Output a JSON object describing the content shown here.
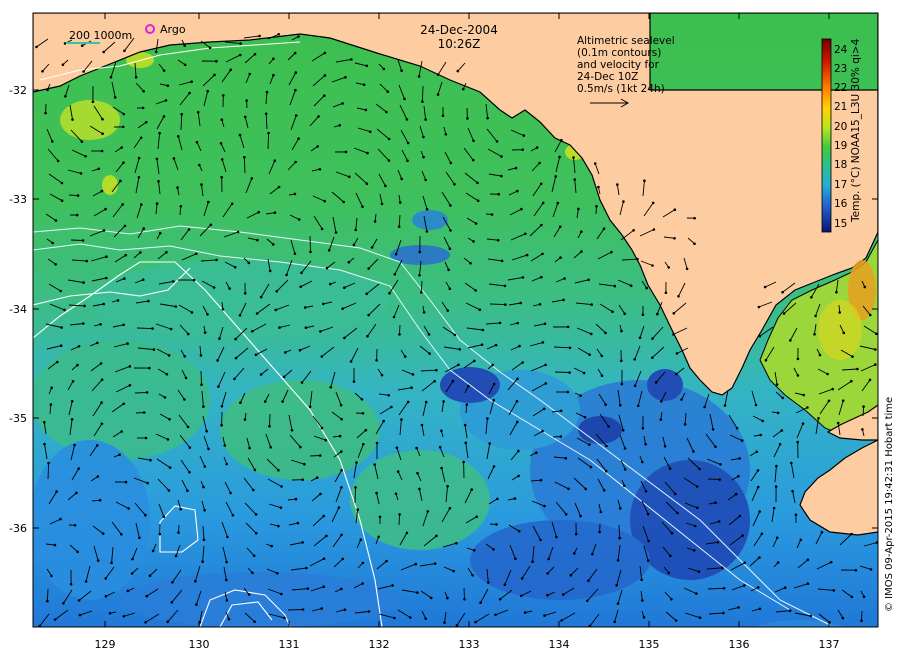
{
  "title": {
    "date": "24-Dec-2004",
    "time": "10:26Z"
  },
  "scale_bar": {
    "label": "200  1000m"
  },
  "argo_legend": {
    "label": "Argo"
  },
  "velocity_note": {
    "lines": [
      "Altimetric sealevel",
      "(0.1m contours)",
      "and velocity for",
      "24-Dec 10Z",
      "0.5m/s (1kt 24h)"
    ]
  },
  "colorbar": {
    "ticks": [
      "24",
      "23",
      "22",
      "21",
      "20",
      "19",
      "18",
      "17",
      "16",
      "15"
    ],
    "label": "Temp. (°C) NOAA15_L3U 30% qi>4",
    "colors": [
      "#7a0000",
      "#b40000",
      "#e63000",
      "#ff7a00",
      "#ffc800",
      "#c8e600",
      "#5fd02a",
      "#2ec878",
      "#2ab4c8",
      "#2a82e6",
      "#1f46c8",
      "#0a1e8c"
    ]
  },
  "credit": "© IMOS 09-Apr-2015 19:42:31 Hobart time",
  "axes": {
    "x_ticks": [
      "129",
      "130",
      "131",
      "132",
      "133",
      "134",
      "135",
      "136",
      "137"
    ],
    "y_ticks": [
      "-32",
      "-33",
      "-34",
      "-35",
      "-36"
    ]
  },
  "colors": {
    "land": "#fdcda1",
    "warm_sst": "#3ec25a",
    "cool_sst": "#2fb8c8",
    "cold_sst": "#1e3cb4"
  }
}
